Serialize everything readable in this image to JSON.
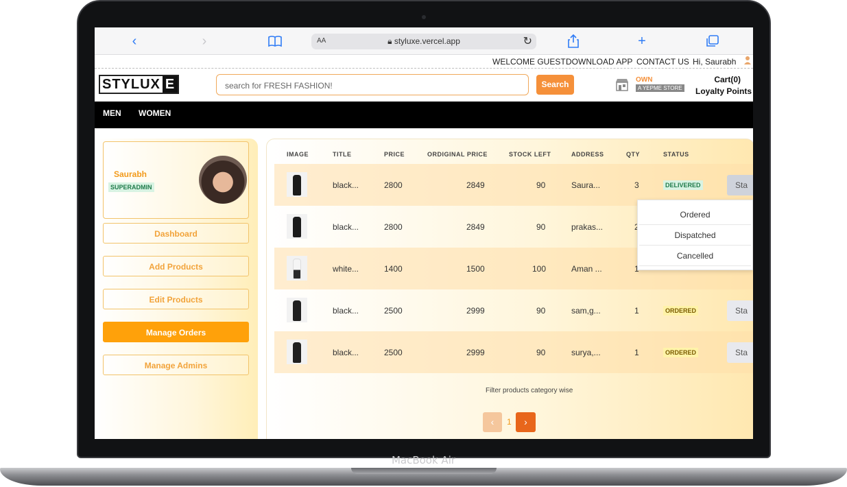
{
  "device": {
    "label": "MacBook Air"
  },
  "browser": {
    "icons": [
      "back-chevron-icon",
      "forward-chevron-icon",
      "bookmarks-book-icon",
      "share-icon",
      "new-tab-plus-icon",
      "tabs-icon"
    ],
    "aa_label": "AA",
    "url": "styluxe.vercel.app"
  },
  "utility_bar": {
    "welcome": "WELCOME GUEST",
    "download": "DOWNLOAD APP",
    "contact": "CONTACT US",
    "greeting": "Hi, Saurabh"
  },
  "header": {
    "logo_a": "STYLUX",
    "logo_b": "E",
    "search_placeholder": "search for FRESH FASHION!",
    "search_button": "Search",
    "own_label": "OWN",
    "store_label": "A YEPME STORE",
    "cart": "Cart(0)",
    "loyalty": "Loyalty Points"
  },
  "nav": {
    "items": [
      "MEN",
      "WOMEN"
    ]
  },
  "sidebar": {
    "name": "Saurabh",
    "role": "SUPERADMIN",
    "menu": [
      "Dashboard",
      "Add Products",
      "Edit Products",
      "Manage Orders",
      "Manage Admins"
    ],
    "active": "Manage Orders"
  },
  "orders": {
    "columns": [
      "IMAGE",
      "TITLE",
      "PRICE",
      "ORDIGINAL PRICE",
      "STOCK LEFT",
      "ADDRESS",
      "QTY",
      "STATUS"
    ],
    "rows": [
      {
        "title": "black...",
        "price": "2800",
        "original": "2849",
        "stock": "90",
        "address": "Saura...",
        "qty": "3",
        "status": "DELIVERED",
        "action": "Sta"
      },
      {
        "title": "black...",
        "price": "2800",
        "original": "2849",
        "stock": "90",
        "address": "prakas...",
        "qty": "2",
        "status": "",
        "action": ""
      },
      {
        "title": "white...",
        "price": "1400",
        "original": "1500",
        "stock": "100",
        "address": "Aman ...",
        "qty": "1",
        "status": "",
        "action": ""
      },
      {
        "title": "black...",
        "price": "2500",
        "original": "2999",
        "stock": "90",
        "address": "sam,g...",
        "qty": "1",
        "status": "ORDERED",
        "action": "Sta"
      },
      {
        "title": "black...",
        "price": "2500",
        "original": "2999",
        "stock": "90",
        "address": "surya,...",
        "qty": "1",
        "status": "ORDERED",
        "action": "Sta"
      }
    ],
    "dropdown_options": [
      "Ordered",
      "Dispatched",
      "Cancelled"
    ],
    "filter_text": "Filter products category wise",
    "page": "1"
  },
  "colors": {
    "accent": "#ffa10a",
    "search_button": "#f5903a",
    "delivered_bg": "#d8f3e3",
    "ordered_bg": "#fff3a8"
  }
}
